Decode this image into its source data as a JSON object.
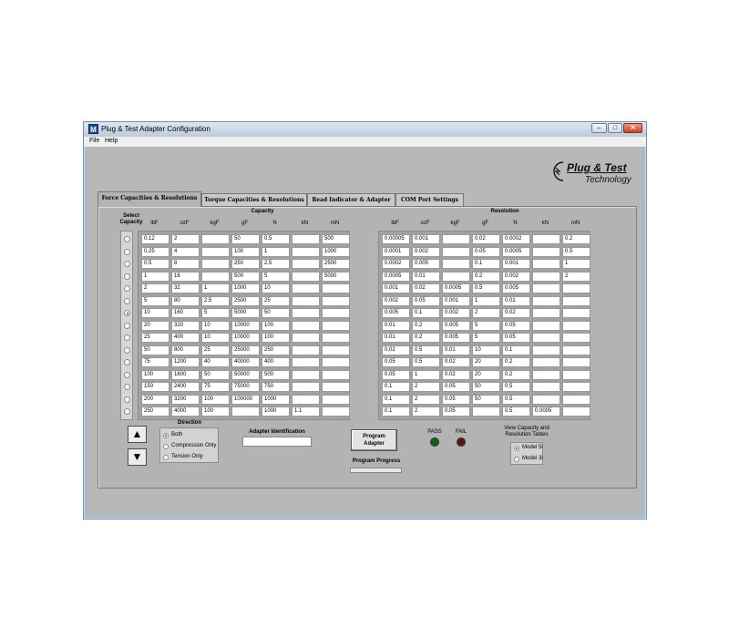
{
  "window": {
    "title": "Plug & Test Adapter Configuration",
    "icon_letter": "M"
  },
  "menu": {
    "file": "File",
    "help": "Help"
  },
  "logo": {
    "line1": "Plug & Test",
    "line2": "Technology"
  },
  "tabs": [
    {
      "label": "Force Capacities & Resolutions",
      "active": true
    },
    {
      "label": "Torque Capacities & Resolutions",
      "active": false
    },
    {
      "label": "Read Indicator & Adapter",
      "active": false
    },
    {
      "label": "COM Port Settings",
      "active": false
    }
  ],
  "select_capacity_label": "Select Capacity",
  "selected_row": 6,
  "capacity": {
    "title": "Capacity",
    "headers": [
      "lbF",
      "ozF",
      "kgF",
      "gF",
      "N",
      "kN",
      "mN"
    ],
    "rows": [
      [
        "0.12",
        "2",
        "",
        "50",
        "0.5",
        "",
        "500"
      ],
      [
        "0.25",
        "4",
        "",
        "100",
        "1",
        "",
        "1000"
      ],
      [
        "0.5",
        "8",
        "",
        "250",
        "2.5",
        "",
        "2500"
      ],
      [
        "1",
        "16",
        "",
        "500",
        "5",
        "",
        "5000"
      ],
      [
        "2",
        "32",
        "1",
        "1000",
        "10",
        "",
        ""
      ],
      [
        "5",
        "80",
        "2.5",
        "2500",
        "25",
        "",
        ""
      ],
      [
        "10",
        "160",
        "5",
        "5000",
        "50",
        "",
        ""
      ],
      [
        "20",
        "320",
        "10",
        "10000",
        "100",
        "",
        ""
      ],
      [
        "25",
        "400",
        "10",
        "10000",
        "100",
        "",
        ""
      ],
      [
        "50",
        "800",
        "25",
        "25000",
        "250",
        "",
        ""
      ],
      [
        "75",
        "1200",
        "40",
        "40000",
        "400",
        "",
        ""
      ],
      [
        "100",
        "1600",
        "50",
        "50000",
        "500",
        "",
        ""
      ],
      [
        "150",
        "2400",
        "75",
        "75000",
        "750",
        "",
        ""
      ],
      [
        "200",
        "3200",
        "100",
        "100000",
        "1000",
        "",
        ""
      ],
      [
        "250",
        "4000",
        "100",
        "",
        "1000",
        "1.1",
        ""
      ]
    ]
  },
  "resolution": {
    "title": "Resolution",
    "headers": [
      "lbF",
      "ozF",
      "kgF",
      "gF",
      "N",
      "kN",
      "mN"
    ],
    "rows": [
      [
        "0.00005",
        "0.001",
        "",
        "0.02",
        "0.0002",
        "",
        "0.2"
      ],
      [
        "0.0001",
        "0.002",
        "",
        "0.05",
        "0.0005",
        "",
        "0.5"
      ],
      [
        "0.0002",
        "0.005",
        "",
        "0.1",
        "0.001",
        "",
        "1"
      ],
      [
        "0.0005",
        "0.01",
        "",
        "0.2",
        "0.002",
        "",
        "2"
      ],
      [
        "0.001",
        "0.02",
        "0.0005",
        "0.5",
        "0.005",
        "",
        ""
      ],
      [
        "0.002",
        "0.05",
        "0.001",
        "1",
        "0.01",
        "",
        ""
      ],
      [
        "0.005",
        "0.1",
        "0.002",
        "2",
        "0.02",
        "",
        ""
      ],
      [
        "0.01",
        "0.2",
        "0.005",
        "5",
        "0.05",
        "",
        ""
      ],
      [
        "0.01",
        "0.2",
        "0.005",
        "5",
        "0.05",
        "",
        ""
      ],
      [
        "0.02",
        "0.5",
        "0.01",
        "10",
        "0.1",
        "",
        ""
      ],
      [
        "0.05",
        "0.5",
        "0.02",
        "20",
        "0.2",
        "",
        ""
      ],
      [
        "0.05",
        "1",
        "0.02",
        "20",
        "0.2",
        "",
        ""
      ],
      [
        "0.1",
        "2",
        "0.05",
        "50",
        "0.5",
        "",
        ""
      ],
      [
        "0.1",
        "2",
        "0.05",
        "50",
        "0.5",
        "",
        ""
      ],
      [
        "0.1",
        "2",
        "0.05",
        "",
        "0.5",
        "0.0005",
        ""
      ]
    ]
  },
  "direction": {
    "title": "Direction",
    "options": [
      "Both",
      "Compression Only",
      "Tension Only"
    ],
    "selected": 0
  },
  "adapter_identification": {
    "label": "Adapter Identification",
    "value": ""
  },
  "program_button": {
    "label_line1": "Program",
    "label_line2": "Adapter"
  },
  "program_progress": {
    "label": "Program Progress",
    "value": 0
  },
  "indicators": {
    "pass": {
      "label": "PASS",
      "color": "#1d5a1d"
    },
    "fail": {
      "label": "FAIL",
      "color": "#5a1616"
    }
  },
  "view_tables": {
    "label_line1": "View Capacity and",
    "label_line2": "Resolution Tables",
    "options": [
      "Model 5i",
      "Model 3i"
    ],
    "selected": 0
  }
}
